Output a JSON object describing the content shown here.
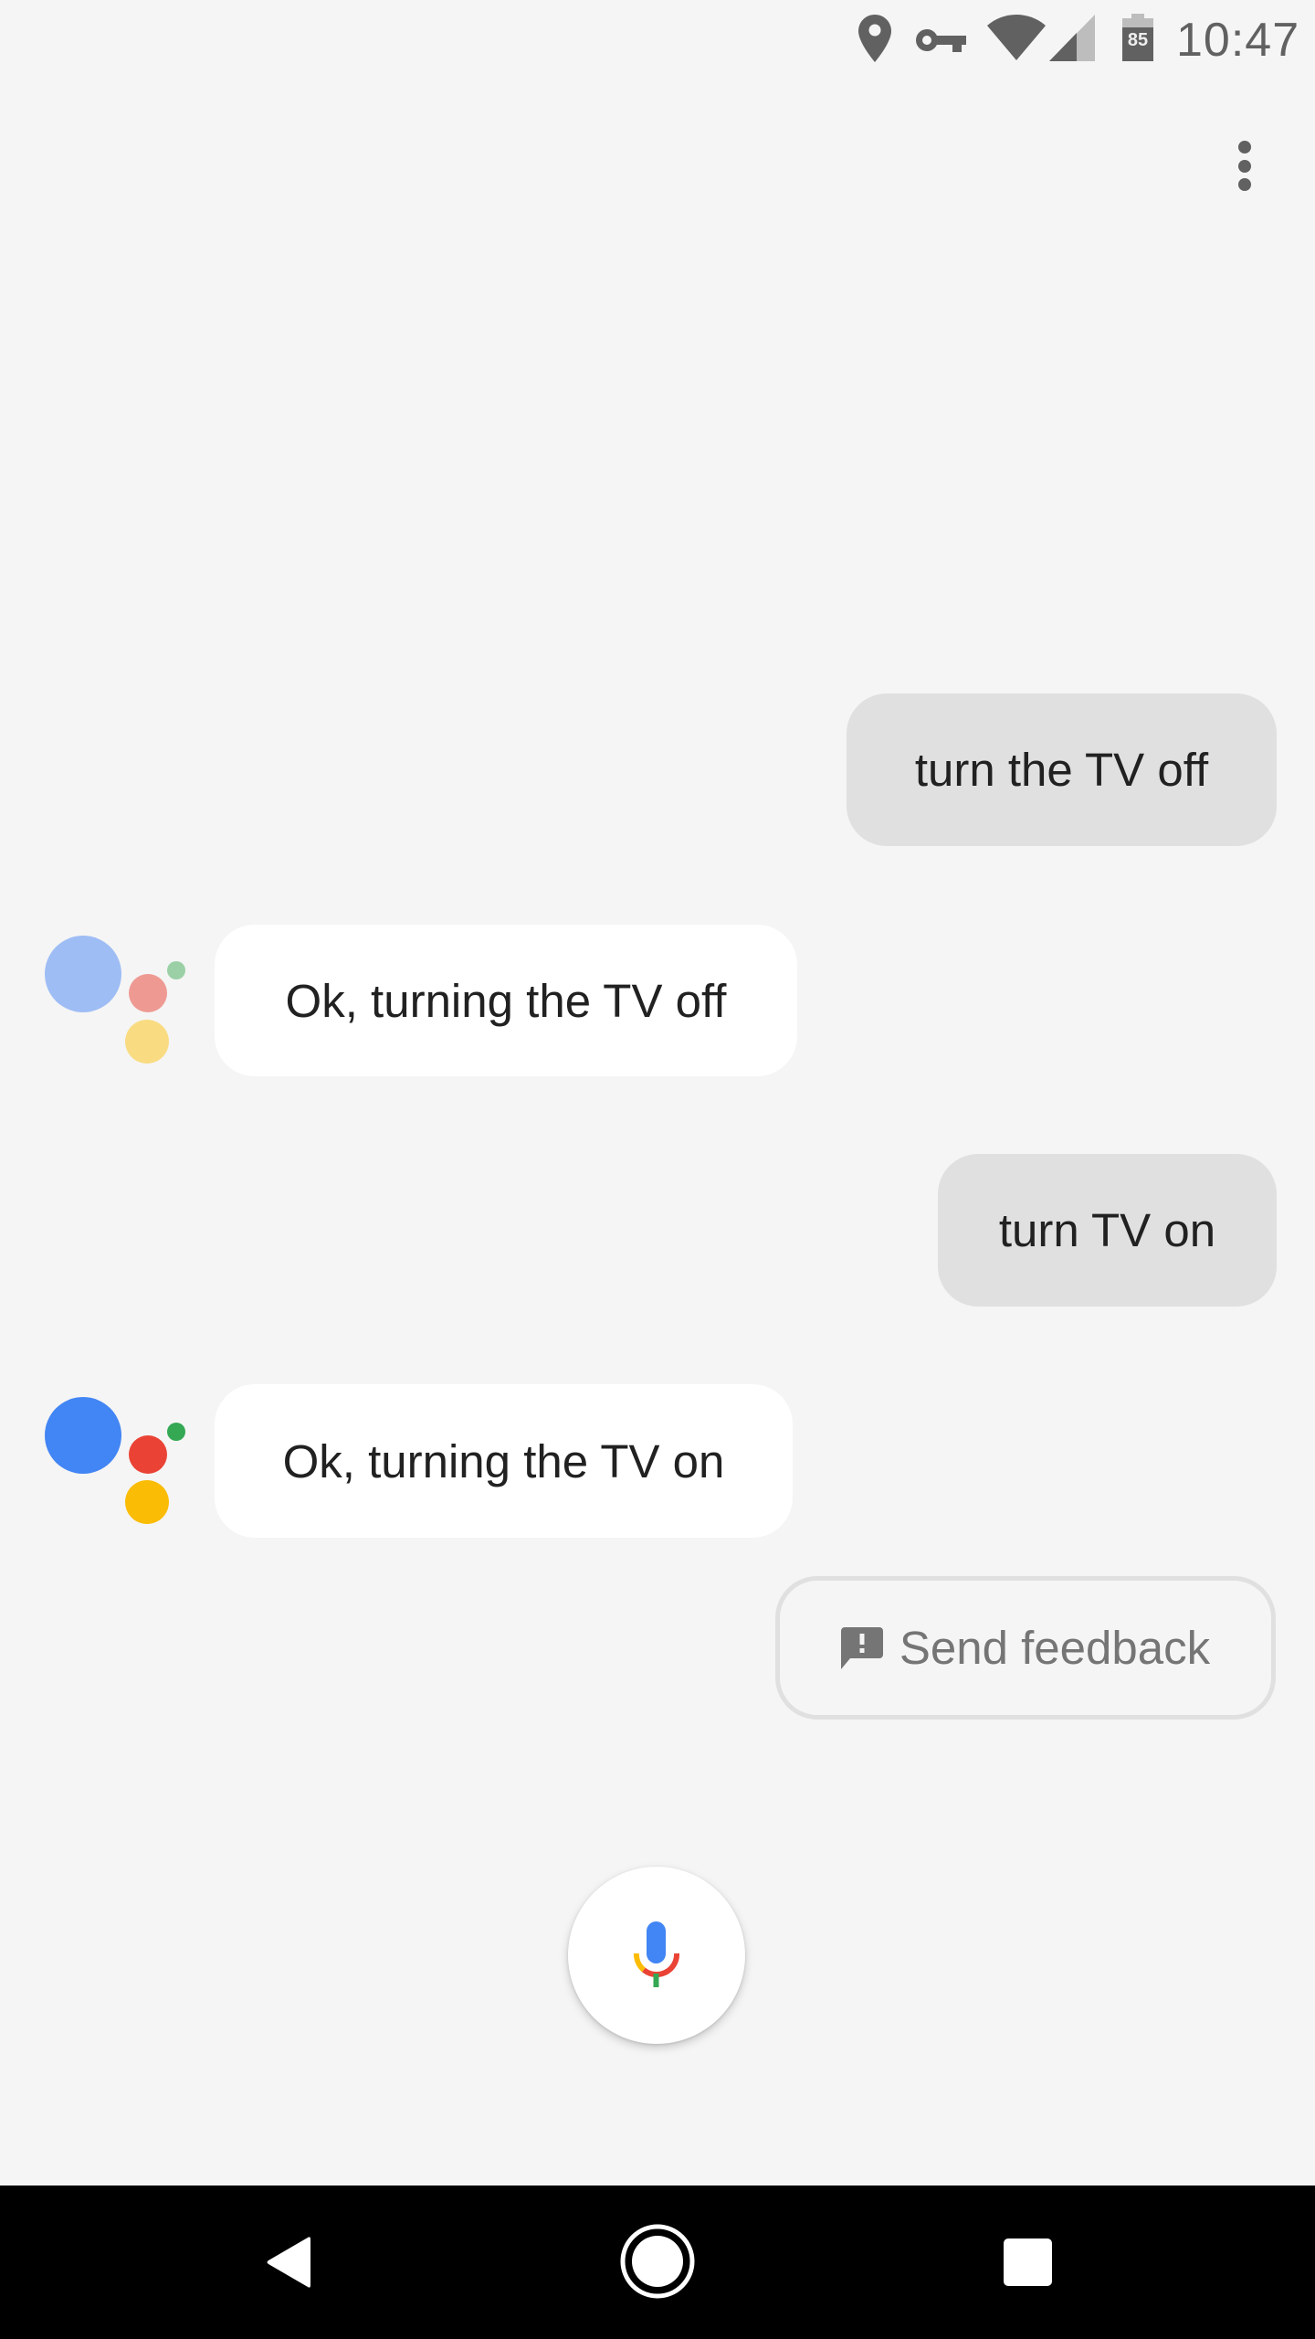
{
  "status_bar": {
    "time": "10:47",
    "battery_level": "85",
    "icons": [
      "location-icon",
      "vpn-key-icon",
      "wifi-icon",
      "cell-signal-icon",
      "battery-icon"
    ]
  },
  "toolbar": {
    "overflow_menu_icon": "more-vert-icon"
  },
  "conversation": [
    {
      "role": "user",
      "text": "turn the TV off"
    },
    {
      "role": "assistant",
      "text": "Ok, turning the TV off",
      "logo_state": "faded"
    },
    {
      "role": "user",
      "text": "turn TV on"
    },
    {
      "role": "assistant",
      "text": "Ok, turning the TV on",
      "logo_state": "active"
    }
  ],
  "feedback": {
    "label": "Send feedback",
    "icon": "feedback-icon"
  },
  "mic": {
    "icon": "microphone-icon"
  },
  "navigation": {
    "back_icon": "back-triangle-icon",
    "home_icon": "home-circle-icon",
    "recents_icon": "recents-square-icon"
  },
  "colors": {
    "background": "#f5f5f5",
    "user_bubble": "#e0e0e0",
    "assistant_bubble": "#ffffff",
    "google_blue": "#4285f4",
    "google_red": "#ea4335",
    "google_yellow": "#fbbc05",
    "google_green": "#34a853",
    "faded_blue": "#9ebdf5",
    "faded_red": "#ee9a93",
    "faded_yellow": "#f9dc82",
    "faded_green": "#9bd0a6",
    "icon_grey": "#616161",
    "text_dark": "#212121",
    "text_grey": "#757575"
  }
}
